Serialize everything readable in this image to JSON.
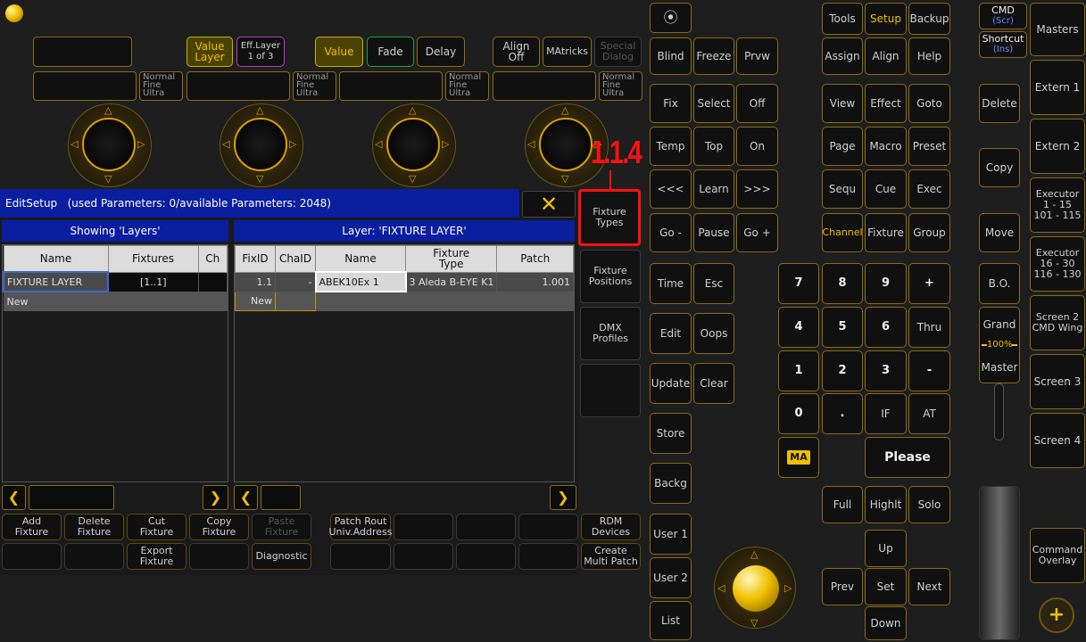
{
  "editor": {
    "title": "EditSetup",
    "params": "(used Parameters: 0/available Parameters: 2048)",
    "close_label": "✕",
    "layers_header": "Showing 'Layers'",
    "layer_header": "Layer: 'FIXTURE LAYER'",
    "layers_columns": [
      "Name",
      "Fixtures",
      "Ch"
    ],
    "layers_rows": [
      [
        "FIXTURE LAYER",
        "[1..1]",
        ""
      ],
      [
        "New",
        "",
        ""
      ]
    ],
    "fixture_columns": [
      "FixID",
      "ChaID",
      "Name",
      "Fixture\nType",
      "Patch"
    ],
    "fixture_rows": [
      [
        "1.1",
        "-",
        "ABEK10Ex 1",
        "3 Aleda B-EYE K1",
        "1.001"
      ],
      [
        "New",
        "",
        "",
        "",
        ""
      ]
    ],
    "side_tabs": [
      "Fixture\nTypes",
      "Fixture\nPositions",
      "DMX\nProfiles",
      ""
    ],
    "callout": "1.1.4",
    "bottom_row1": [
      "Add\nFixture",
      "Delete\nFixture",
      "Cut\nFixture",
      "Copy\nFixture",
      "Paste\nFixture",
      "Patch Rout\nUniv.Address",
      "",
      "",
      "",
      "RDM\nDevices"
    ],
    "bottom_row2": [
      "",
      "",
      "Export\nFixture",
      "",
      "Diagnostic",
      "",
      "",
      "",
      "",
      "Create\nMulti Patch"
    ]
  },
  "top": {
    "value_layer": "Value\nLayer",
    "eff_layer": "Eff.Layer\n1 of 3",
    "value": "Value",
    "fade": "Fade",
    "delay": "Delay",
    "align": "Align\nOff",
    "matricks": "MAtricks",
    "special_dialog": "Special\nDialog",
    "resolution": "Normal\nFine\nUltra"
  },
  "keys": {
    "circle": "⦿",
    "blind": "Blind",
    "freeze": "Freeze",
    "prvw": "Prvw",
    "fix": "Fix",
    "select": "Select",
    "off": "Off",
    "temp": "Temp",
    "top": "Top",
    "on": "On",
    "prev_page": "<<<",
    "learn": "Learn",
    "next_page": ">>>",
    "go_minus": "Go -",
    "pause": "Pause",
    "go_plus": "Go +",
    "time": "Time",
    "esc": "Esc",
    "edit": "Edit",
    "oops": "Oops",
    "update": "Update",
    "clear": "Clear",
    "store": "Store",
    "backg": "Backg",
    "user1": "User 1",
    "user2": "User 2",
    "list": "List",
    "tools": "Tools",
    "setup": "Setup",
    "backup": "Backup",
    "assign": "Assign",
    "align": "Align",
    "help": "Help",
    "view": "View",
    "effect": "Effect",
    "goto": "Goto",
    "page": "Page",
    "macro": "Macro",
    "preset": "Preset",
    "sequ": "Sequ",
    "cue": "Cue",
    "exec": "Exec",
    "channel": "Channel",
    "fixture": "Fixture",
    "group": "Group",
    "n7": "7",
    "n8": "8",
    "n9": "9",
    "plus": "+",
    "n4": "4",
    "n5": "5",
    "n6": "6",
    "thru": "Thru",
    "n1": "1",
    "n2": "2",
    "n3": "3",
    "minus": "-",
    "n0": "0",
    "dot": ".",
    "if": "IF",
    "at": "AT",
    "ma": "MA",
    "please": "Please",
    "full": "Full",
    "highlt": "Highlt",
    "solo": "Solo",
    "up": "Up",
    "prev": "Prev",
    "set": "Set",
    "next": "Next",
    "down": "Down",
    "cmd": "CMD",
    "cmd_sub": "(Scr)",
    "shortcut": "Shortcut",
    "shortcut_sub": "(Ins)",
    "delete": "Delete",
    "copy": "Copy",
    "move": "Move",
    "bo": "B.O.",
    "grand": "Grand",
    "grand_pct": "100%",
    "master": "Master",
    "masters": "Masters",
    "extern1": "Extern 1",
    "extern2": "Extern 2",
    "exec1": "Executor\n1 - 15\n101 - 115",
    "exec2": "Executor\n16 - 30\n116 - 130",
    "screen2": "Screen 2\nCMD Wing",
    "screen3": "Screen 3",
    "screen4": "Screen 4",
    "cmd_overlay": "Command\nOverlay",
    "plus_icon": "+"
  },
  "colors": {
    "accent": "#f0c000",
    "title_bar": "#0a1ea0",
    "callout": "#ff1010"
  }
}
